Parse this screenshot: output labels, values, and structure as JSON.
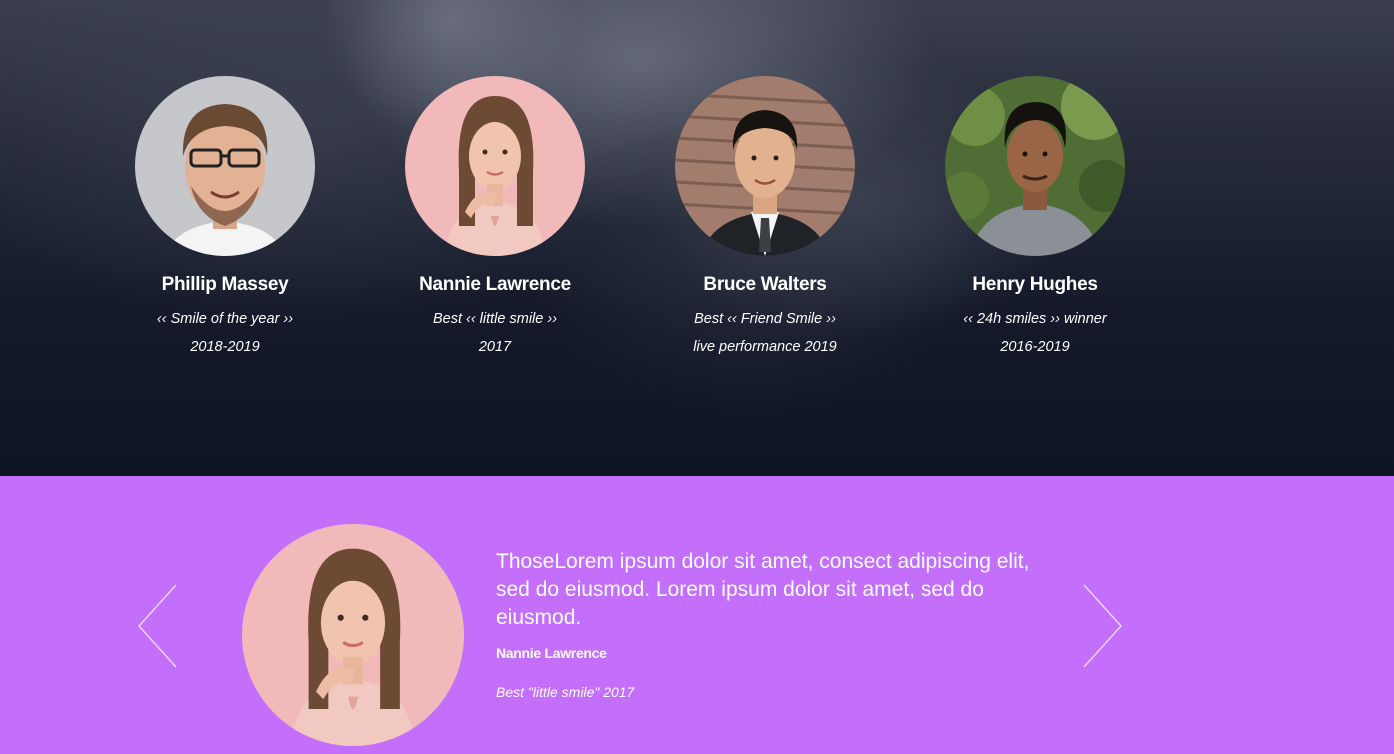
{
  "team": {
    "members": [
      {
        "name": "Phillip Massey",
        "award_line1": "‹‹ Smile of the year ››",
        "award_line2": "2018-2019"
      },
      {
        "name": "Nannie Lawrence",
        "award_line1": "Best ‹‹ little smile ››",
        "award_line2": "2017"
      },
      {
        "name": "Bruce Walters",
        "award_line1": "Best ‹‹ Friend Smile ››",
        "award_line2": "live performance 2019"
      },
      {
        "name": "Henry Hughes",
        "award_line1": "‹‹ 24h smiles ›› winner",
        "award_line2": "2016-2019"
      }
    ]
  },
  "testimonial": {
    "quote": "ThoseLorem ipsum dolor sit amet, consect adipiscing elit, sed do eiusmod. Lorem ipsum dolor sit amet, sed do eiusmod.",
    "author": "Nannie Lawrence",
    "role": "Best \"little smile\" 2017",
    "prev_icon": "chevron-left-icon",
    "next_icon": "chevron-right-icon"
  },
  "colors": {
    "team_background": "#141a2a",
    "testimonial_background": "#c36ffb",
    "text": "#ffffff"
  }
}
